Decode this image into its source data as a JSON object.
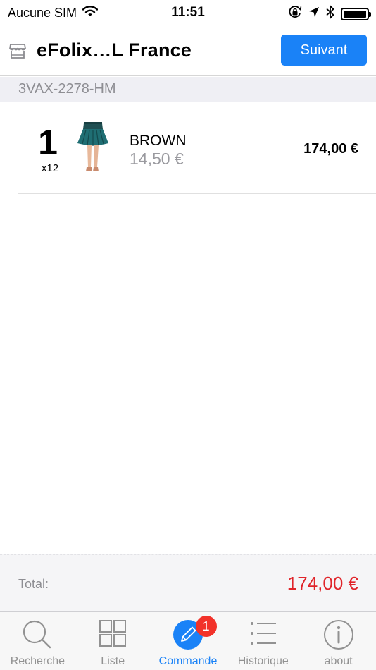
{
  "status_bar": {
    "carrier": "Aucune SIM",
    "time": "11:51",
    "icons": [
      "wifi-icon",
      "orientation-lock-icon",
      "location-arrow-icon",
      "bluetooth-icon",
      "battery-icon"
    ]
  },
  "nav": {
    "icon": "store-icon",
    "title": "eFolix…L France",
    "next_label": "Suivant"
  },
  "section": {
    "header": "3VAX-2278-HM"
  },
  "order_item": {
    "quantity": "1",
    "pack": "x12",
    "product_name": "BROWN",
    "unit_price": "14,50 €",
    "line_total": "174,00 €"
  },
  "totals": {
    "label": "Total:",
    "value": "174,00 €"
  },
  "tabs": [
    {
      "label": "Recherche",
      "icon": "search-icon",
      "active": false
    },
    {
      "label": "Liste",
      "icon": "grid-icon",
      "active": false
    },
    {
      "label": "Commande",
      "icon": "pencil-icon",
      "active": true,
      "badge": "1"
    },
    {
      "label": "Historique",
      "icon": "list-icon",
      "active": false
    },
    {
      "label": "about",
      "icon": "info-icon",
      "active": false
    }
  ],
  "colors": {
    "accent": "#1a82f7",
    "total_red": "#e0242a",
    "badge_red": "#f2322a"
  }
}
